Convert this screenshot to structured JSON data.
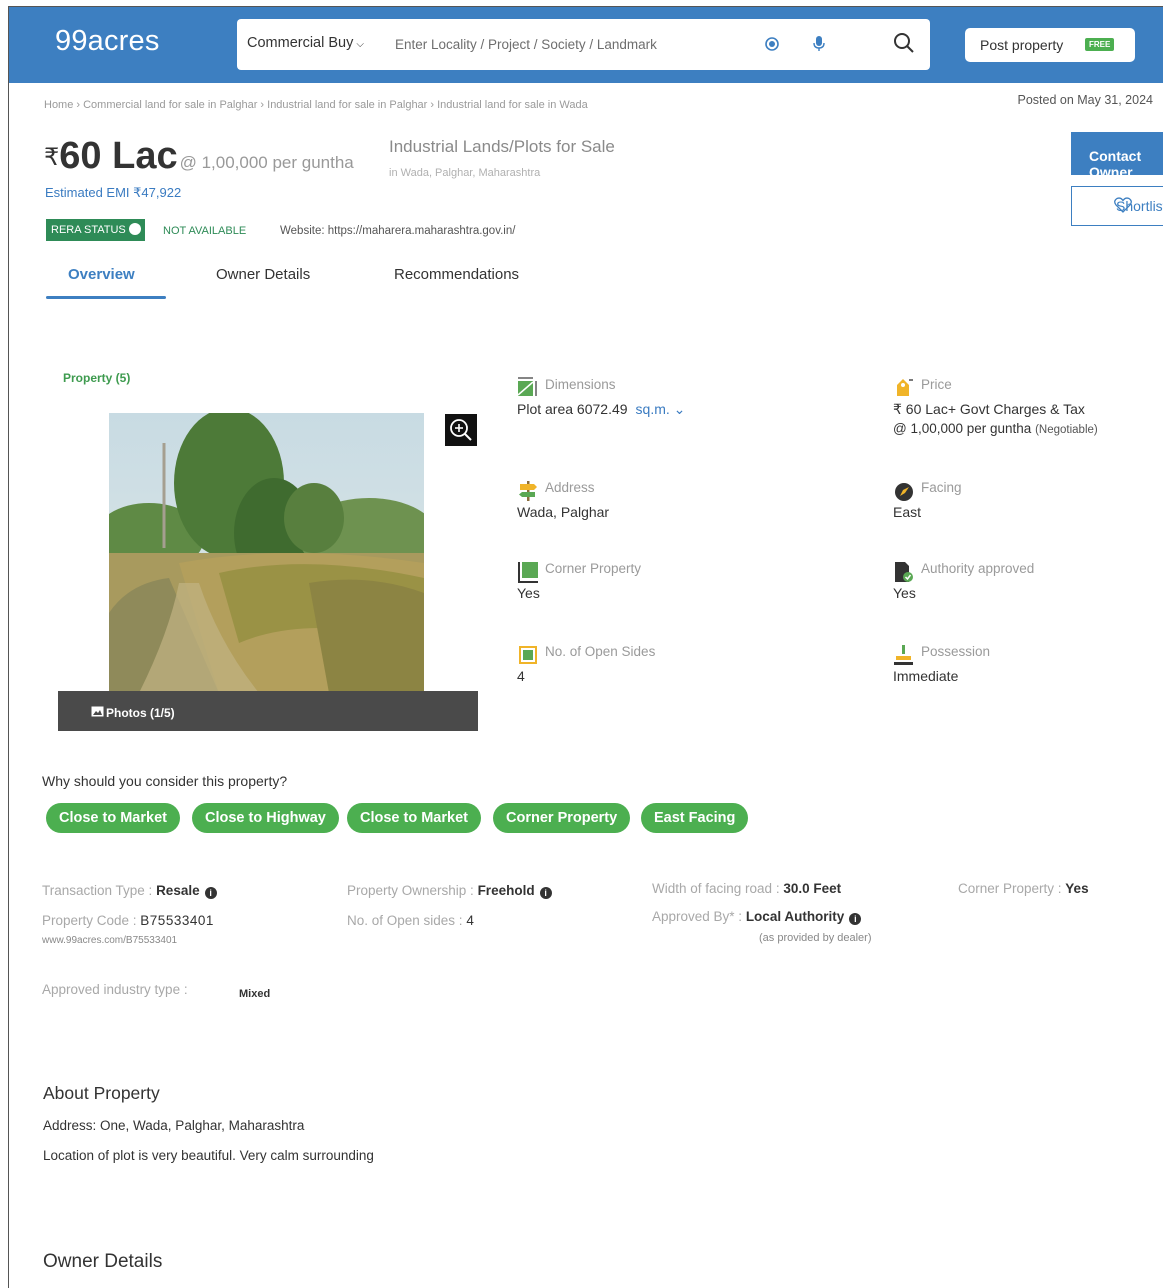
{
  "header": {
    "logo": "99acres",
    "search_type": "Commercial Buy",
    "search_placeholder": "Enter Locality / Project / Society / Landmark",
    "post_property": "Post property",
    "free_badge": "FREE"
  },
  "breadcrumb": "Home › Commercial land for sale in Palghar › Industrial land for sale in Palghar › Industrial land for sale in Wada",
  "posted_on": "Posted on May 31, 2024",
  "listing": {
    "rupee": "₹",
    "price": "60 Lac",
    "rate": "@ 1,00,000 per guntha",
    "emi": "Estimated EMI ₹47,922",
    "title": "Industrial Lands/Plots for Sale",
    "location": "in Wada, Palghar, Maharashtra",
    "contact_btn": "Contact Owner",
    "shortlist_btn": "Shortlist"
  },
  "rera": {
    "badge": "RERA STATUS",
    "status": "NOT AVAILABLE",
    "website": "Website: https://maharera.maharashtra.gov.in/"
  },
  "tabs": [
    "Overview",
    "Owner Details",
    "Recommendations"
  ],
  "gallery": {
    "label": "Property (5)",
    "photos_label": "Photos (1/5)"
  },
  "facts": {
    "dimensions": {
      "label": "Dimensions",
      "value": "Plot area 6072.49",
      "unit": "sq.m."
    },
    "price": {
      "label": "Price",
      "value": "₹ 60 Lac+ Govt Charges & Tax",
      "value2": "@ 1,00,000 per guntha",
      "note": "(Negotiable)"
    },
    "address": {
      "label": "Address",
      "value": "Wada, Palghar"
    },
    "facing": {
      "label": "Facing",
      "value": "East"
    },
    "corner": {
      "label": "Corner Property",
      "value": "Yes"
    },
    "authority": {
      "label": "Authority approved",
      "value": "Yes"
    },
    "open_sides": {
      "label": "No. of Open Sides",
      "value": "4"
    },
    "possession": {
      "label": "Possession",
      "value": "Immediate"
    }
  },
  "why": {
    "title": "Why should you consider this property?",
    "chips": [
      "Close to Market",
      "Close to Highway",
      "Close to Market",
      "Corner Property",
      "East Facing"
    ]
  },
  "details": {
    "transaction_k": "Transaction Type : ",
    "transaction_v": "Resale",
    "ownership_k": "Property Ownership : ",
    "ownership_v": "Freehold",
    "road_k": "Width of facing road : ",
    "road_v": "30.0 Feet",
    "corner_k": "Corner Property : ",
    "corner_v": "Yes",
    "code_k": "Property Code : ",
    "code_v": "B75533401",
    "code_url": "www.99acres.com/B75533401",
    "sides_k": "No. of Open sides : ",
    "sides_v": "4",
    "approved_k": "Approved By* : ",
    "approved_v": "Local Authority",
    "dealer_note": "(as provided by dealer)",
    "industry_k": "Approved industry type :",
    "industry_v": "Mixed"
  },
  "about": {
    "title": "About Property",
    "address": "Address: One, Wada, Palghar, Maharashtra",
    "desc": "Location of plot is very beautiful. Very calm surrounding"
  },
  "owner_title": "Owner Details",
  "colors": {
    "brand": "#3d7fc1",
    "green": "#4caf50",
    "rera": "#2e8b57"
  }
}
